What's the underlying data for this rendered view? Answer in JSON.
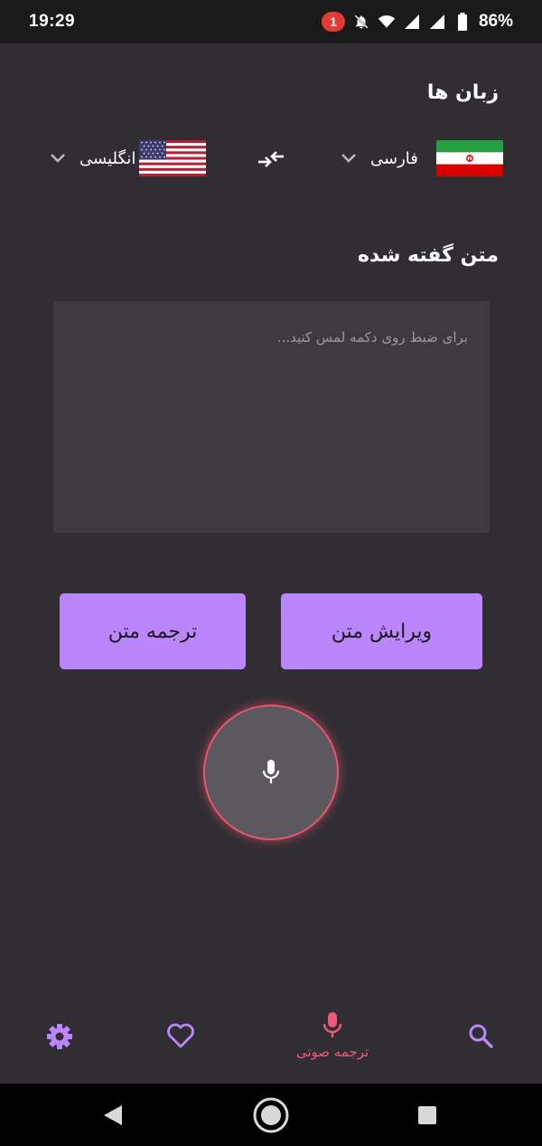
{
  "status_bar": {
    "time": "19:29",
    "notification_count": "1",
    "battery": "86%"
  },
  "languages_section": {
    "title": "زبان ها",
    "source": {
      "label": "فارسی",
      "flag": "iran-flag"
    },
    "target": {
      "label": "انگلیسی",
      "flag": "usa-flag"
    },
    "swap_icon": "swap-arrows-icon"
  },
  "spoken_section": {
    "title": "متن گفته شده",
    "value": "",
    "placeholder": "برای ضبط روی دکمه لمس کنید..."
  },
  "buttons": {
    "edit_label": "ویرایش متن",
    "translate_label": "ترجمه متن"
  },
  "mic": {
    "icon": "microphone-icon"
  },
  "bottom_nav": {
    "items": [
      {
        "icon": "search-icon",
        "label": ""
      },
      {
        "icon": "microphone-icon",
        "label": "ترجمه صوتی",
        "active": true
      },
      {
        "icon": "heart-icon",
        "label": ""
      },
      {
        "icon": "gear-icon",
        "label": ""
      }
    ]
  },
  "colors": {
    "background": "#312e33",
    "accent": "#bb86fc",
    "active": "#f0587a",
    "mic_ring": "#e8546f"
  }
}
